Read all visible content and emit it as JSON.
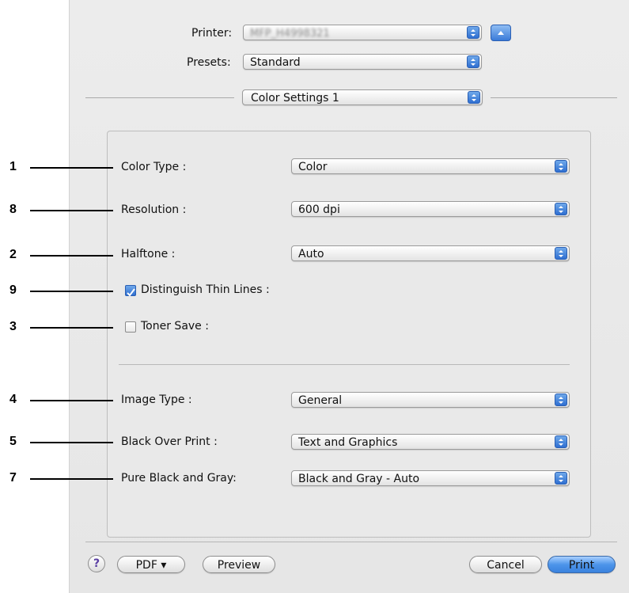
{
  "header": {
    "printer_label": "Printer:",
    "printer_value": "MFP_H4998321",
    "presets_label": "Presets:",
    "presets_value": "Standard",
    "panel_value": "Color Settings 1"
  },
  "settings": {
    "color_type": {
      "callout": "1",
      "label": "Color Type :",
      "value": "Color"
    },
    "resolution": {
      "callout": "8",
      "label": "Resolution :",
      "value": "600 dpi"
    },
    "halftone": {
      "callout": "2",
      "label": "Halftone :",
      "value": "Auto"
    },
    "thin_lines": {
      "callout": "9",
      "label": "Distinguish Thin Lines :",
      "checked": true
    },
    "toner_save": {
      "callout": "3",
      "label": "Toner Save :",
      "checked": false
    },
    "image_type": {
      "callout": "4",
      "label": "Image Type :",
      "value": "General"
    },
    "black_over_print": {
      "callout": "5",
      "label": "Black Over Print :",
      "value": "Text and Graphics"
    },
    "pure_black_gray": {
      "callout": "7",
      "label": "Pure Black and Gray:",
      "value": "Black and Gray - Auto"
    }
  },
  "footer": {
    "help_label": "?",
    "pdf_label": "PDF ▾",
    "preview_label": "Preview",
    "cancel_label": "Cancel",
    "print_label": "Print"
  },
  "icons": [
    "popup-arrows-icon",
    "disclosure-up-icon",
    "checkmark-icon",
    "help-icon"
  ],
  "colors": {
    "accent": "#3a7ad8",
    "dialog_bg": "#e8e8e8"
  }
}
